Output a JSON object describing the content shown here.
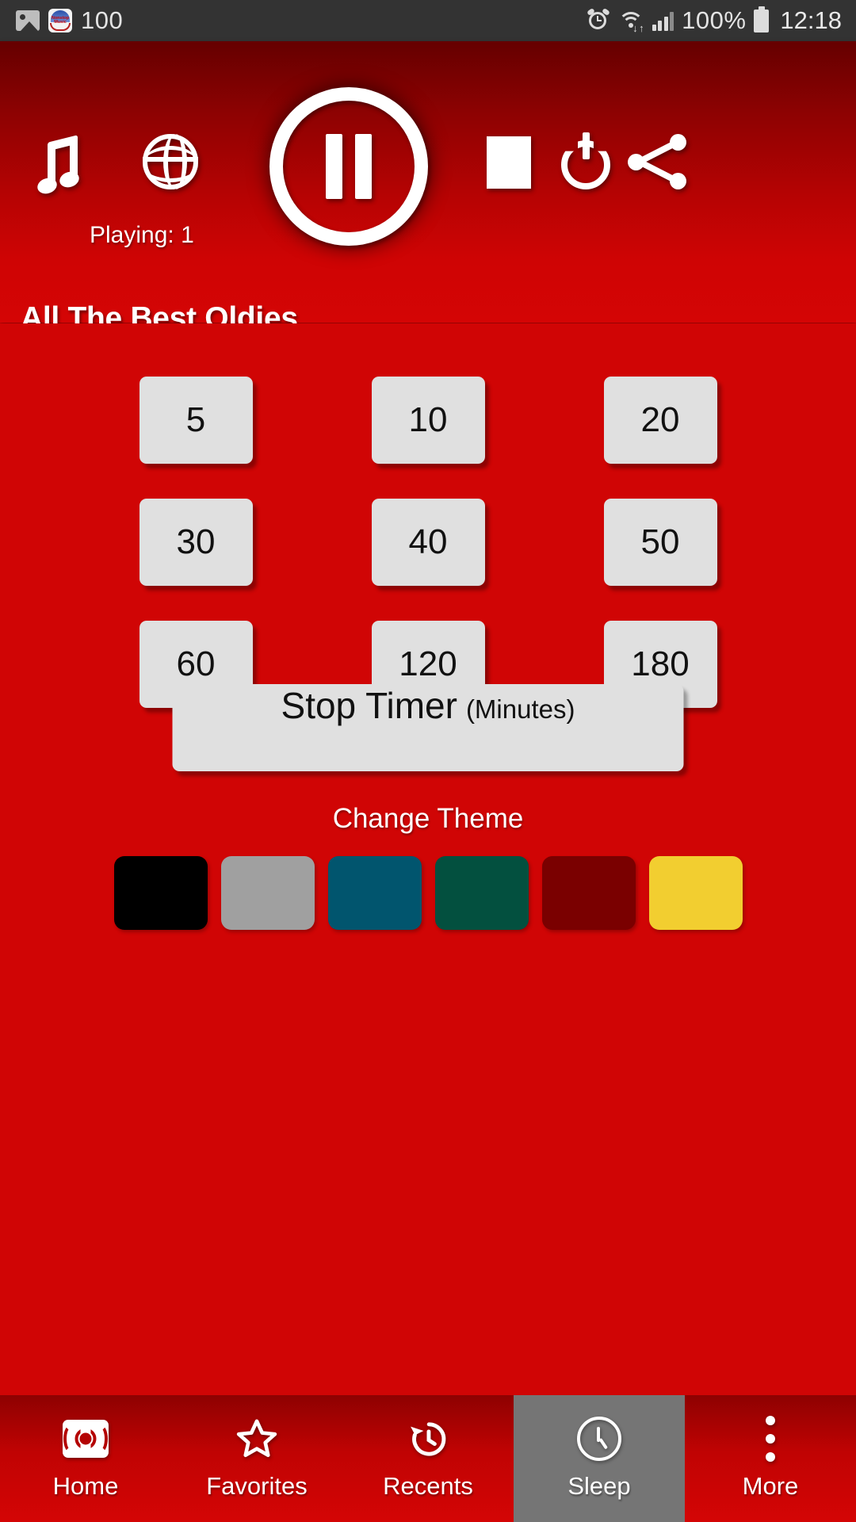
{
  "statusbar": {
    "icons": [
      "image-icon",
      "app-nonstop-music-icon",
      "alarm-icon",
      "wifi-icon",
      "signal-icon",
      "battery-icon"
    ],
    "notification_count": "100",
    "battery_percent": "100%",
    "time": "12:18"
  },
  "player": {
    "music_icon": "music-note-icon",
    "globe_icon": "globe-icon",
    "play_icon": "pause-icon",
    "stop_icon": "stop-icon",
    "power_icon": "power-icon",
    "share_icon": "share-icon",
    "playing_label": "Playing: 1",
    "station_title": "All The Best Oldies"
  },
  "sleep_timer": {
    "rows": [
      [
        "5",
        "10",
        "20"
      ],
      [
        "30",
        "40",
        "50"
      ],
      [
        "60",
        "120",
        "180"
      ]
    ],
    "stop_button": {
      "main": "Stop Timer",
      "unit": "(Minutes)"
    }
  },
  "theme": {
    "title": "Change Theme",
    "swatches": [
      {
        "name": "black",
        "color": "#000000"
      },
      {
        "name": "gray",
        "color": "#a0a0a0"
      },
      {
        "name": "teal",
        "color": "#01556e"
      },
      {
        "name": "green",
        "color": "#03503f"
      },
      {
        "name": "maroon",
        "color": "#7a0000"
      },
      {
        "name": "yellow",
        "color": "#f2ce30"
      }
    ]
  },
  "bottomnav": {
    "items": [
      {
        "label": "Home",
        "icon": "radio-icon",
        "active": false
      },
      {
        "label": "Favorites",
        "icon": "star-icon",
        "active": false
      },
      {
        "label": "Recents",
        "icon": "history-icon",
        "active": false
      },
      {
        "label": "Sleep",
        "icon": "clock-icon",
        "active": true
      },
      {
        "label": "More",
        "icon": "more-icon",
        "active": false
      }
    ]
  },
  "colors": {
    "primary_red": "#d00505",
    "header_dark": "#650000",
    "button_gray": "#e0e0e0",
    "active_tab": "#757575",
    "statusbar_bg": "#333333"
  }
}
